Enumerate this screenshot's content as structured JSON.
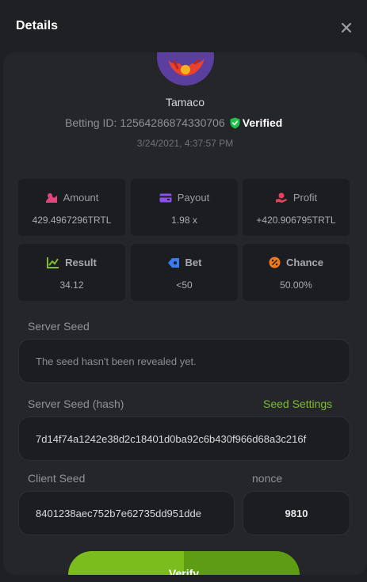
{
  "header": {
    "title": "Details"
  },
  "player": {
    "name": "Tamaco",
    "betting_id_label": "Betting ID:",
    "betting_id": "12564286874330706",
    "verified_label": "Verified",
    "datetime": "3/24/2021, 4:37:57 PM"
  },
  "stats": [
    {
      "label": "Amount",
      "value": "429.4967296TRTL",
      "icon": "coins-icon",
      "color": "#e0457b"
    },
    {
      "label": "Payout",
      "value": "1.98 x",
      "icon": "wallet-icon",
      "color": "#8e4ff0"
    },
    {
      "label": "Profit",
      "value": "+420.906795TRTL",
      "icon": "hand-coin-icon",
      "color": "#e0455a"
    },
    {
      "label": "Result",
      "value": "34.12",
      "icon": "chart-icon",
      "color": "#7ebd2a"
    },
    {
      "label": "Bet",
      "value": "<50",
      "icon": "tag-icon",
      "color": "#3a7cf0"
    },
    {
      "label": "Chance",
      "value": "50.00%",
      "icon": "percent-icon",
      "color": "#f07a1a"
    }
  ],
  "server_seed": {
    "label": "Server Seed",
    "value": "The seed hasn't been revealed yet."
  },
  "server_seed_hash": {
    "label": "Server Seed (hash)",
    "settings_link": "Seed Settings",
    "value": "7d14f74a1242e38d2c18401d0ba92c6b430f966d68a3c216f"
  },
  "client_seed": {
    "label": "Client Seed",
    "value": "8401238aec752b7e62735dd951dde"
  },
  "nonce": {
    "label": "nonce",
    "value": "9810"
  },
  "verify_button": {
    "label": "Verify"
  },
  "colors": {
    "accent_green": "#7ebd2a",
    "verified_green": "#1fc34a"
  }
}
